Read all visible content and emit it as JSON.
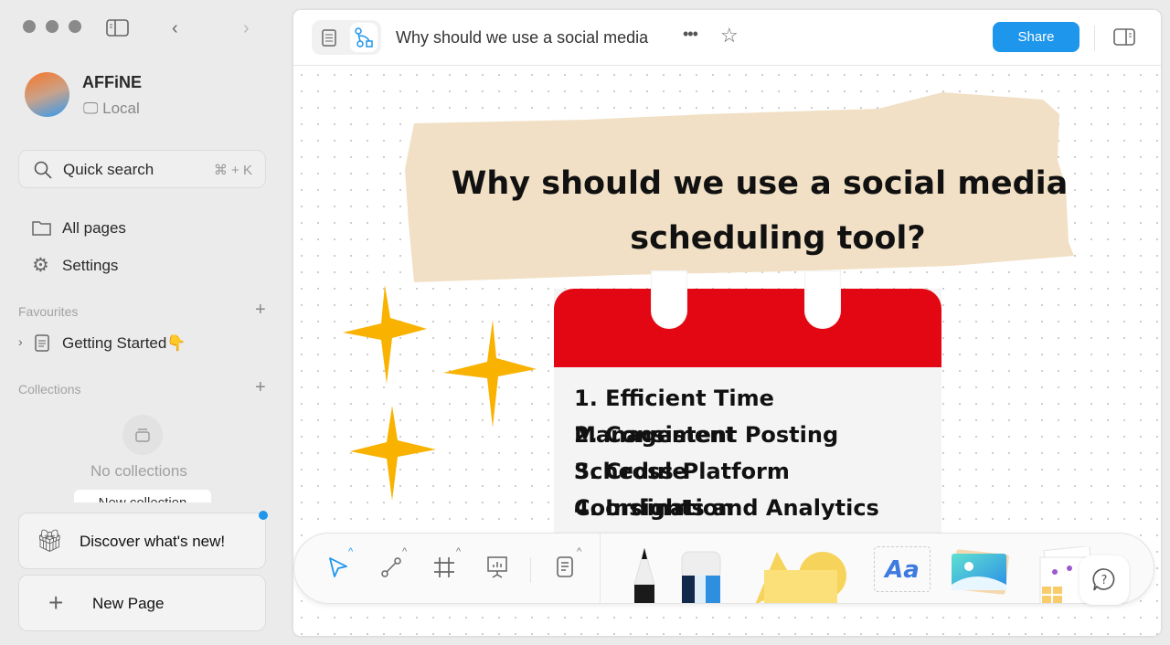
{
  "window": {
    "title": "Why should we use a social media"
  },
  "sidebar": {
    "workspace": {
      "name": "AFFiNE",
      "type": "Local"
    },
    "search": {
      "label": "Quick search",
      "shortcut": "⌘ + K"
    },
    "nav": [
      {
        "label": "All pages",
        "icon": "folder-icon"
      },
      {
        "label": "Settings",
        "icon": "gear-icon"
      }
    ],
    "favourites": {
      "title": "Favourites",
      "items": [
        {
          "label": "Getting Started👇"
        }
      ]
    },
    "collections": {
      "title": "Collections",
      "empty": "No collections",
      "new_button": "New collection"
    },
    "discover": "Discover what's new!",
    "new_page": "New Page"
  },
  "topbar": {
    "doc_title": "Why should we use a social media",
    "share": "Share",
    "mode": "edgeless"
  },
  "canvas": {
    "banner_line1": "Why should we use a social media",
    "banner_line2": "scheduling tool?",
    "list": [
      "1. Efficient Time Management",
      "2. Consistent Posting Schedule",
      "3. Cross-Platform Coordination",
      "4. Insights and Analytics"
    ],
    "colors": {
      "banner": "#f1e0c5",
      "calendar_top": "#e30613",
      "sparkle": "#f9b200",
      "accent": "#1e96eb"
    }
  },
  "toolbar": {
    "text_tool": "Aa"
  }
}
